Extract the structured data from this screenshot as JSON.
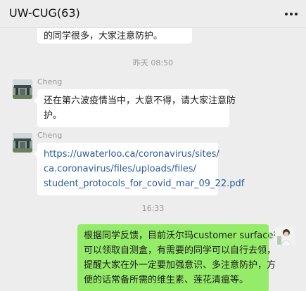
{
  "header": {
    "title": "UW-CUG(63)",
    "more_icon": "more-dots-icon"
  },
  "messages": {
    "clipped_text": "的同学很多，大家注意防护。",
    "time1": "昨天 08:50",
    "msg1": {
      "sender": "Cheng",
      "lines": [
        "还在第六波疫情当中，大意不得，请大家注意防",
        "护。"
      ]
    },
    "msg2": {
      "sender": "Cheng",
      "lines": [
        "https://uwaterloo.ca/coronavirus/sites/",
        "ca.coronavirus/files/uploads/files/",
        "student_protocols_for_covid_mar_09_22.pdf"
      ]
    },
    "time2": "16:33",
    "msg3": {
      "lines": [
        "根据同学反馈，目前沃尔玛customer surface有",
        "可以领取自测盒，有需要的同学可以自行去领，",
        "提醒大家在外一定要加强意识、多注意防护，方",
        "便的话常备所需的维生素、莲花清瘟等。"
      ]
    }
  },
  "colors": {
    "self_bubble": "#95ec69",
    "other_bubble": "#ffffff",
    "background": "#ededed",
    "link": "#2a5c9a"
  }
}
